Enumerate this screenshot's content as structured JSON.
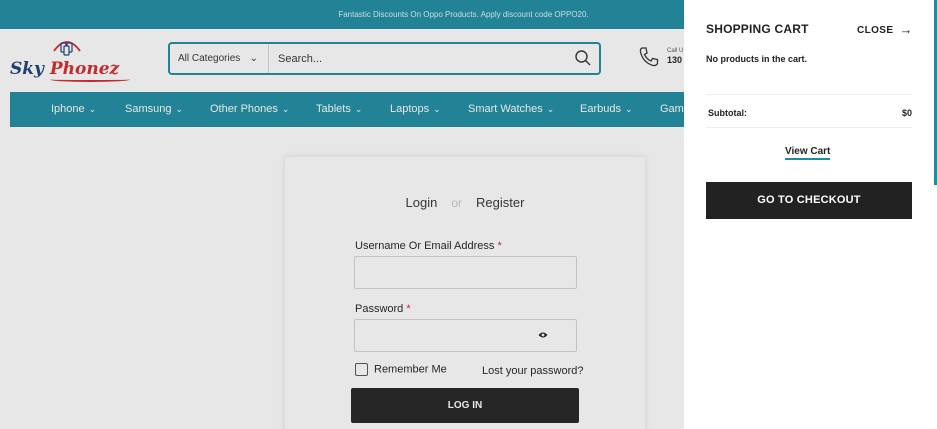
{
  "announcement": "Fantastic Discounts On Oppo Products. Apply discount code OPPO20.",
  "logo": {
    "part1": "Sky",
    "part2": "Phonez"
  },
  "search": {
    "category": "All Categories",
    "placeholder": "Search..."
  },
  "call": {
    "label": "Call U",
    "number": "130"
  },
  "nav": {
    "items": [
      {
        "label": "Iphone"
      },
      {
        "label": "Samsung"
      },
      {
        "label": "Other Phones"
      },
      {
        "label": "Tablets"
      },
      {
        "label": "Laptops"
      },
      {
        "label": "Smart Watches"
      },
      {
        "label": "Earbuds"
      },
      {
        "label": "Gam"
      }
    ]
  },
  "login": {
    "tab_login": "Login",
    "tab_or": "or",
    "tab_register": "Register",
    "username_label": "Username Or Email Address",
    "password_label": "Password",
    "required_mark": "*",
    "remember": "Remember Me",
    "lost_password": "Lost your password?",
    "submit": "LOG IN"
  },
  "cart": {
    "title": "SHOPPING CART",
    "close": "CLOSE",
    "empty": "No products in the cart.",
    "subtotal_label": "Subtotal:",
    "subtotal_value": "$0",
    "view_cart": "View Cart",
    "checkout": "GO TO CHECKOUT"
  },
  "colors": {
    "brand": "#1d8da3",
    "logo_red": "#d8262b",
    "logo_blue": "#1c3f78",
    "button": "#222222"
  }
}
